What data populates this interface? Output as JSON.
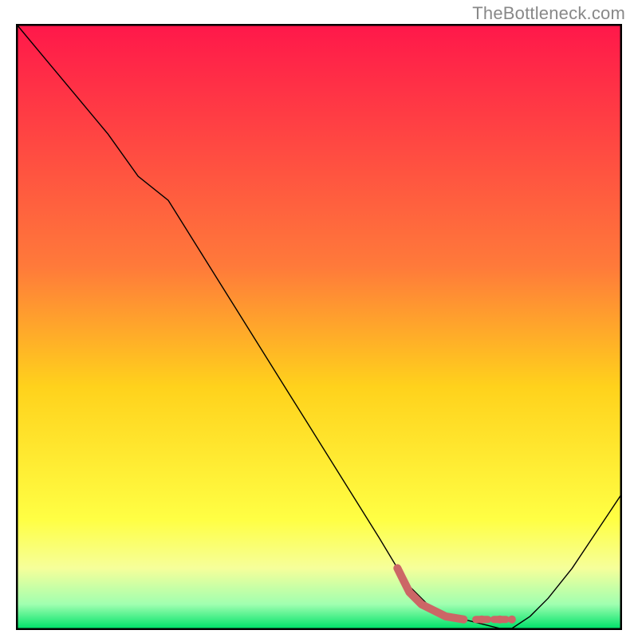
{
  "watermark": "TheBottleneck.com",
  "chart_data": {
    "type": "line",
    "title": "",
    "xlabel": "",
    "ylabel": "",
    "xlim": [
      0,
      100
    ],
    "ylim": [
      0,
      100
    ],
    "grid": false,
    "series": [
      {
        "name": "bottleneck-curve",
        "x": [
          0,
          5,
          10,
          15,
          20,
          25,
          30,
          35,
          40,
          45,
          50,
          55,
          60,
          63,
          65,
          68,
          72,
          76,
          80,
          82,
          85,
          88,
          92,
          96,
          100
        ],
        "y": [
          100,
          94,
          88,
          82,
          75,
          71,
          63,
          55,
          47,
          39,
          31,
          23,
          15,
          10,
          7,
          4,
          2,
          1,
          0,
          0,
          2,
          5,
          10,
          16,
          22
        ],
        "color": "#000000",
        "width": 1.4
      }
    ],
    "markers": [
      {
        "name": "highlight-trough",
        "points": [
          {
            "x": 63,
            "y": 10
          },
          {
            "x": 64,
            "y": 8
          },
          {
            "x": 65,
            "y": 6
          },
          {
            "x": 66,
            "y": 5
          },
          {
            "x": 67,
            "y": 4
          },
          {
            "x": 69,
            "y": 3
          },
          {
            "x": 71,
            "y": 2
          },
          {
            "x": 74,
            "y": 1.5
          },
          {
            "x": 77,
            "y": 1.5
          },
          {
            "x": 80,
            "y": 1.5
          },
          {
            "x": 82,
            "y": 1.5
          }
        ],
        "color": "#cc6666",
        "size": 5
      }
    ],
    "background_gradient": {
      "stops": [
        {
          "y": 100,
          "color": "#ff184a"
        },
        {
          "y": 60,
          "color": "#ff7a3a"
        },
        {
          "y": 40,
          "color": "#ffd21c"
        },
        {
          "y": 18,
          "color": "#ffff44"
        },
        {
          "y": 10,
          "color": "#f6ff9a"
        },
        {
          "y": 4,
          "color": "#a0ffb0"
        },
        {
          "y": 0,
          "color": "#00e26a"
        }
      ]
    }
  },
  "colors": {
    "frame": "#000000",
    "watermark": "#888888"
  }
}
